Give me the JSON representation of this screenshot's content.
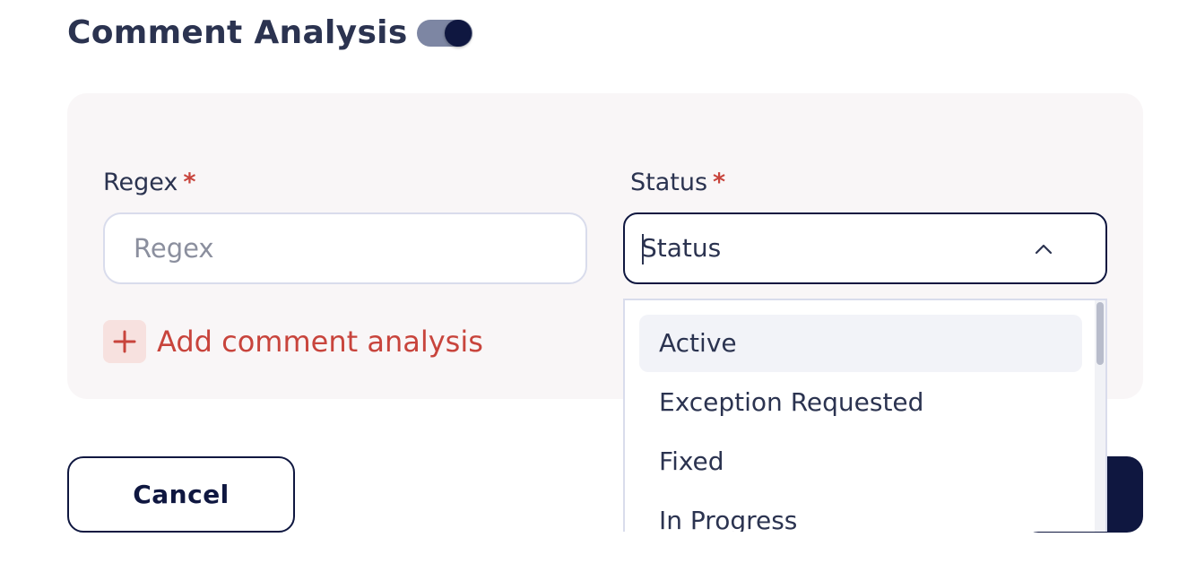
{
  "header": {
    "title": "Comment Analysis",
    "toggle_on": true
  },
  "form": {
    "regex": {
      "label": "Regex",
      "required_mark": "*",
      "placeholder": "Regex",
      "value": ""
    },
    "status": {
      "label": "Status",
      "required_mark": "*",
      "value": "Status",
      "options": [
        "Active",
        "Exception Requested",
        "Fixed",
        "In Progress"
      ],
      "highlighted_option": "Active"
    },
    "add_label": "Add comment analysis"
  },
  "actions": {
    "cancel_label": "Cancel"
  },
  "colors": {
    "primary": "#0f1740",
    "accent_red": "#c8443c",
    "card_bg": "#f9f6f7"
  }
}
